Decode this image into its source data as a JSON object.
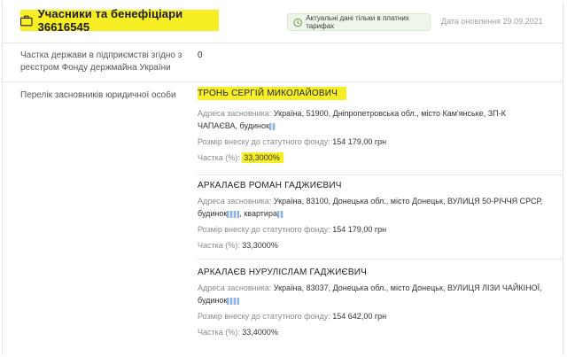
{
  "header": {
    "title": "Учасники та бенефіціари 36616545",
    "notice": "Актуальні дані тільки в платних тарифах",
    "updated": "Дата оновлення 29.09.2021"
  },
  "state_share": {
    "label_line1": "Частка держави в підприємстві згідно з",
    "label_line2": "реєстром Фонду держмайна України",
    "value": "0"
  },
  "founders_label": "Перелік засновників юридичної особи",
  "founders": [
    {
      "name": "ТРОНЬ СЕРГІЙ МИКОЛАЙОВИЧ",
      "address_key": "Адреса засновника:",
      "address_line1": "Україна, 51900, Дніпропетровська обл., місто Кам'янське, ЗП-К",
      "address_line2": "ЧАПАЄВА, будинок",
      "capital_key": "Розмір внеску до статутного фонду:",
      "capital_value": "154 179,00 грн",
      "share_key": "Частка (%):",
      "share_value": "33,3000%"
    },
    {
      "name": "АРКАЛАЄВ РОМАН ГАДЖИЄВИЧ",
      "address_key": "Адреса засновника:",
      "address_line1": "Україна, 83100, Донецька обл., місто Донецьк, ВУЛИЦЯ 50-РІЧЧЯ СРСР,",
      "address_line2a": "будинок",
      "address_line2b": ", квартира",
      "capital_key": "Розмір внеску до статутного фонду:",
      "capital_value": "154 179,00 грн",
      "share_key": "Частка (%):",
      "share_value": "33,3000%"
    },
    {
      "name": "АРКАЛАЄВ НУРУЛІСЛАМ ГАДЖИЄВИЧ",
      "address_key": "Адреса засновника:",
      "address_line1": "Україна, 83037, Донецька обл., місто Донецьк, ВУЛИЦЯ ЛІЗИ ЧАЙКІНОЇ,",
      "address_line2": "будинок",
      "capital_key": "Розмір внеску до статутного фонду:",
      "capital_value": "154 642,00 грн",
      "share_key": "Частка (%):",
      "share_value": "33,4000%"
    }
  ]
}
